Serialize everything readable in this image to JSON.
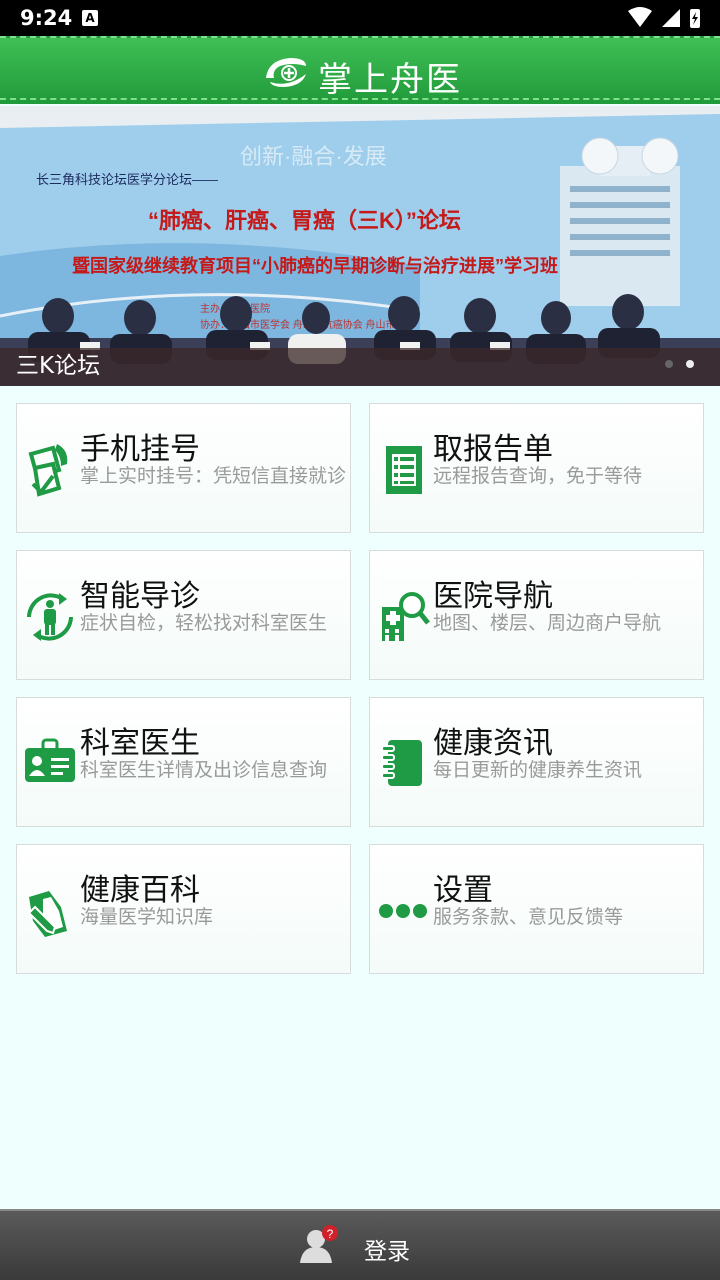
{
  "status_bar": {
    "time": "9:24",
    "notification_icon": "A"
  },
  "header": {
    "title": "掌上舟医"
  },
  "banner": {
    "caption": "三K论坛",
    "slide_count": 2,
    "active_slide": 2,
    "slogan": "创新·融合·发展",
    "forum_line": "长三角科技论坛医学分论坛——",
    "headline": "“肺癌、肝癌、胃癌（三K）”论坛",
    "subline": "暨国家级继续教育项目“小肺癌的早期诊断与治疗进展”学习班",
    "host_line_1": "主办：舟山医院",
    "host_line_2": "协办：舟山市医学会  舟山市抗癌协会  舟山市"
  },
  "tiles": [
    {
      "title": "手机挂号",
      "subtitle": "掌上实时挂号：凭短信直接就诊",
      "icon": "phone-document-icon"
    },
    {
      "title": "取报告单",
      "subtitle": "远程报告查询，免于等待",
      "icon": "report-sheet-icon"
    },
    {
      "title": "智能导诊",
      "subtitle": "症状自检，轻松找对科室医生",
      "icon": "body-check-icon"
    },
    {
      "title": "医院导航",
      "subtitle": "地图、楼层、周边商户导航",
      "icon": "hospital-search-icon"
    },
    {
      "title": "科室医生",
      "subtitle": "科室医生详情及出诊信息查询",
      "icon": "doctor-badge-icon"
    },
    {
      "title": "健康资讯",
      "subtitle": "每日更新的健康养生资讯",
      "icon": "notebook-icon"
    },
    {
      "title": "健康百科",
      "subtitle": "海量医学知识库",
      "icon": "pencil-document-icon"
    },
    {
      "title": "设置",
      "subtitle": "服务条款、意见反馈等",
      "icon": "more-dots-icon"
    }
  ],
  "bottom_bar": {
    "login_label": "登录",
    "badge": "?"
  },
  "colors": {
    "brand_green": "#2aa845",
    "icon_green": "#1f9a45",
    "page_bg": "#effffe"
  }
}
